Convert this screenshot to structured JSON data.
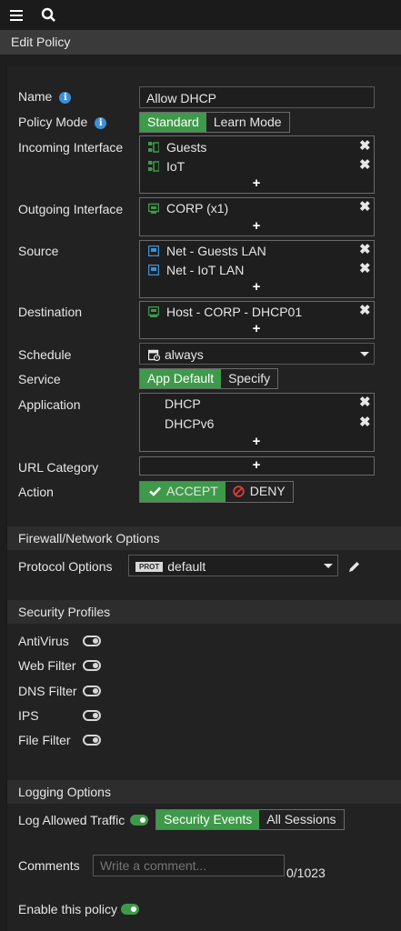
{
  "header": {
    "title": "Edit Policy"
  },
  "form": {
    "name_label": "Name",
    "name_value": "Allow DHCP",
    "policy_mode_label": "Policy Mode",
    "policy_mode_options": [
      "Standard",
      "Learn Mode"
    ],
    "incoming_label": "Incoming Interface",
    "incoming_items": [
      "Guests",
      "IoT"
    ],
    "outgoing_label": "Outgoing Interface",
    "outgoing_items": [
      "CORP (x1)"
    ],
    "source_label": "Source",
    "source_items": [
      "Net - Guests LAN",
      "Net - IoT LAN"
    ],
    "destination_label": "Destination",
    "destination_items": [
      "Host - CORP - DHCP01"
    ],
    "schedule_label": "Schedule",
    "schedule_value": "always",
    "service_label": "Service",
    "service_options": [
      "App Default",
      "Specify"
    ],
    "application_label": "Application",
    "application_items": [
      "DHCP",
      "DHCPv6"
    ],
    "url_category_label": "URL Category",
    "action_label": "Action",
    "action_accept": "ACCEPT",
    "action_deny": "DENY"
  },
  "firewall": {
    "section_title": "Firewall/Network Options",
    "protocol_label": "Protocol Options",
    "protocol_badge": "PROT",
    "protocol_value": "default"
  },
  "security": {
    "section_title": "Security Profiles",
    "profiles": [
      "AntiVirus",
      "Web Filter",
      "DNS Filter",
      "IPS",
      "File Filter"
    ]
  },
  "logging": {
    "section_title": "Logging Options",
    "log_label": "Log Allowed Traffic",
    "log_options": [
      "Security Events",
      "All Sessions"
    ],
    "comments_label": "Comments",
    "comments_placeholder": "Write a comment...",
    "comments_count": "0/1023",
    "enable_label": "Enable this policy"
  },
  "colors": {
    "accent": "#3e9a4a",
    "info": "#3d8fd6",
    "deny": "#e03c3c"
  }
}
